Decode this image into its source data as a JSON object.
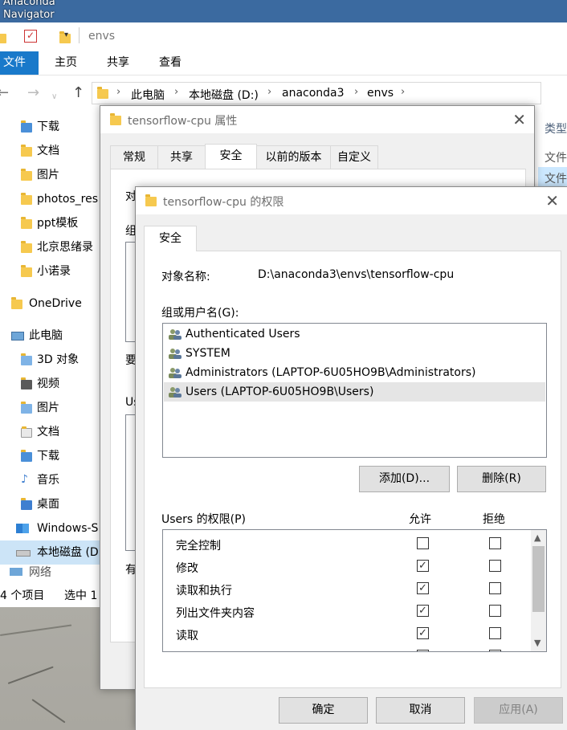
{
  "desktop": {
    "labels": [
      "Anaconda",
      "Navigator"
    ]
  },
  "explorer": {
    "qat_path": "envs",
    "ribbon_tabs": [
      "文件",
      "主页",
      "共享",
      "查看"
    ],
    "breadcrumb": [
      "此电脑",
      "本地磁盘 (D:)",
      "anaconda3",
      "envs"
    ],
    "nav_items": [
      {
        "label": "下载",
        "icon": "download-folder-icon"
      },
      {
        "label": "文档",
        "icon": "documents-icon"
      },
      {
        "label": "图片",
        "icon": "pictures-icon"
      },
      {
        "label": "photos_res",
        "icon": "folder-icon"
      },
      {
        "label": "ppt模板",
        "icon": "folder-icon"
      },
      {
        "label": "北京思绪录",
        "icon": "folder-icon"
      },
      {
        "label": "小诺录",
        "icon": "folder-icon"
      },
      {
        "label": "OneDrive",
        "icon": "onedrive-icon"
      },
      {
        "label": "此电脑",
        "icon": "this-pc-icon"
      },
      {
        "label": "3D 对象",
        "icon": "3d-objects-icon"
      },
      {
        "label": "视频",
        "icon": "videos-icon"
      },
      {
        "label": "图片",
        "icon": "pictures-icon"
      },
      {
        "label": "文档",
        "icon": "documents-icon"
      },
      {
        "label": "下载",
        "icon": "download-folder-icon"
      },
      {
        "label": "音乐",
        "icon": "music-icon"
      },
      {
        "label": "桌面",
        "icon": "desktop-icon"
      },
      {
        "label": "Windows-S",
        "icon": "drive-c-icon"
      },
      {
        "label": "本地磁盘 (D",
        "icon": "drive-d-icon"
      },
      {
        "label": "网络",
        "icon": "network-icon"
      }
    ],
    "right_column": [
      "类型",
      "文件",
      "文件"
    ],
    "status_count": "4 个项目",
    "status_selected": "选中 1"
  },
  "props_dialog": {
    "title": "tensorflow-cpu 属性",
    "tabs": [
      "常规",
      "共享",
      "安全",
      "以前的版本",
      "自定义"
    ],
    "peek_texts": [
      "对",
      "组",
      "要",
      "Us",
      "有"
    ]
  },
  "perms_dialog": {
    "title": "tensorflow-cpu 的权限",
    "tab": "安全",
    "object_label": "对象名称:",
    "object_value": "D:\\anaconda3\\envs\\tensorflow-cpu",
    "group_label": "组或用户名(G):",
    "groups": [
      "Authenticated Users",
      "SYSTEM",
      "Administrators (LAPTOP-6U05HO9B\\Administrators)",
      "Users (LAPTOP-6U05HO9B\\Users)"
    ],
    "add_button": "添加(D)...",
    "remove_button": "删除(R)",
    "perms_label": "Users 的权限(P)",
    "allow_header": "允许",
    "deny_header": "拒绝",
    "permissions": [
      {
        "name": "完全控制",
        "allow": false,
        "deny": false
      },
      {
        "name": "修改",
        "allow": true,
        "deny": false
      },
      {
        "name": "读取和执行",
        "allow": true,
        "deny": false
      },
      {
        "name": "列出文件夹内容",
        "allow": true,
        "deny": false
      },
      {
        "name": "读取",
        "allow": true,
        "deny": false
      }
    ],
    "ok_button": "确定",
    "cancel_button": "取消",
    "apply_button": "应用(A)"
  }
}
